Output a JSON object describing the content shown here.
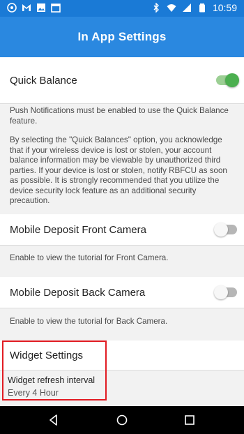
{
  "status_bar": {
    "time": "10:59",
    "left_icons": [
      "chat-icon",
      "gmail-icon",
      "image-icon",
      "calendar-icon"
    ],
    "right_icons": [
      "bluetooth-icon",
      "wifi-icon",
      "signal-icon",
      "battery-icon"
    ]
  },
  "app_bar": {
    "title": "In App Settings",
    "color": "#2a88e0"
  },
  "settings": {
    "quick_balance": {
      "label": "Quick Balance",
      "enabled": true,
      "note": "Push Notifications must be enabled to use the Quick Balance feature.",
      "disclaimer": "By selecting the \"Quick Balances\" option, you acknowledge that if your wireless device is lost or stolen, your account balance information may be viewable by unauthorized third parties. If your device is lost or stolen, notify RBFCU as soon as possible. It is strongly recommended that you utilize the device security lock feature as an additional security precaution."
    },
    "front_camera": {
      "label": "Mobile Deposit Front Camera",
      "enabled": false,
      "description": "Enable to view the tutorial for Front Camera."
    },
    "back_camera": {
      "label": "Mobile Deposit Back Camera",
      "enabled": false,
      "description": "Enable to view the tutorial for Back Camera."
    },
    "widget": {
      "header": "Widget Settings",
      "refresh_label": "Widget refresh interval",
      "refresh_value": "Every 4 Hour"
    }
  },
  "colors": {
    "toggle_on": "#4caf50",
    "highlight": "#e11b22",
    "status_bar": "#1a7ad6"
  },
  "nav_bar": {
    "buttons": [
      "back-icon",
      "home-icon",
      "recents-icon"
    ]
  }
}
